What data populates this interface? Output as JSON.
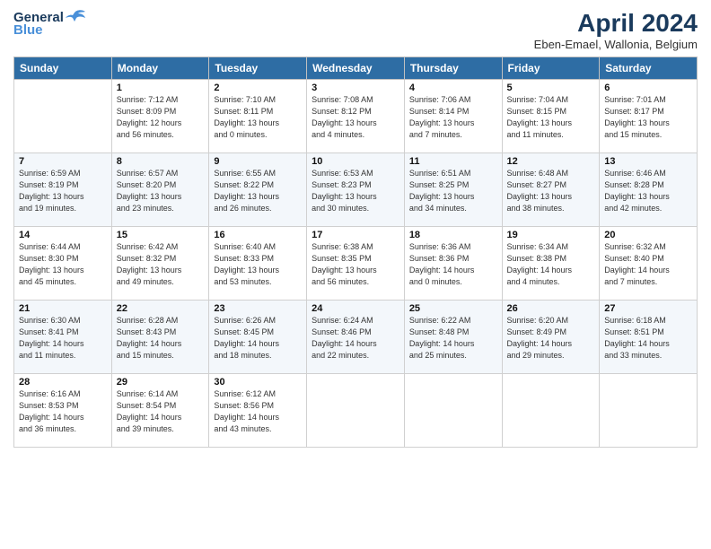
{
  "header": {
    "logo_general": "General",
    "logo_blue": "Blue",
    "title": "April 2024",
    "subtitle": "Eben-Emael, Wallonia, Belgium"
  },
  "days_of_week": [
    "Sunday",
    "Monday",
    "Tuesday",
    "Wednesday",
    "Thursday",
    "Friday",
    "Saturday"
  ],
  "weeks": [
    [
      {
        "day": "",
        "info": ""
      },
      {
        "day": "1",
        "info": "Sunrise: 7:12 AM\nSunset: 8:09 PM\nDaylight: 12 hours\nand 56 minutes."
      },
      {
        "day": "2",
        "info": "Sunrise: 7:10 AM\nSunset: 8:11 PM\nDaylight: 13 hours\nand 0 minutes."
      },
      {
        "day": "3",
        "info": "Sunrise: 7:08 AM\nSunset: 8:12 PM\nDaylight: 13 hours\nand 4 minutes."
      },
      {
        "day": "4",
        "info": "Sunrise: 7:06 AM\nSunset: 8:14 PM\nDaylight: 13 hours\nand 7 minutes."
      },
      {
        "day": "5",
        "info": "Sunrise: 7:04 AM\nSunset: 8:15 PM\nDaylight: 13 hours\nand 11 minutes."
      },
      {
        "day": "6",
        "info": "Sunrise: 7:01 AM\nSunset: 8:17 PM\nDaylight: 13 hours\nand 15 minutes."
      }
    ],
    [
      {
        "day": "7",
        "info": "Sunrise: 6:59 AM\nSunset: 8:19 PM\nDaylight: 13 hours\nand 19 minutes."
      },
      {
        "day": "8",
        "info": "Sunrise: 6:57 AM\nSunset: 8:20 PM\nDaylight: 13 hours\nand 23 minutes."
      },
      {
        "day": "9",
        "info": "Sunrise: 6:55 AM\nSunset: 8:22 PM\nDaylight: 13 hours\nand 26 minutes."
      },
      {
        "day": "10",
        "info": "Sunrise: 6:53 AM\nSunset: 8:23 PM\nDaylight: 13 hours\nand 30 minutes."
      },
      {
        "day": "11",
        "info": "Sunrise: 6:51 AM\nSunset: 8:25 PM\nDaylight: 13 hours\nand 34 minutes."
      },
      {
        "day": "12",
        "info": "Sunrise: 6:48 AM\nSunset: 8:27 PM\nDaylight: 13 hours\nand 38 minutes."
      },
      {
        "day": "13",
        "info": "Sunrise: 6:46 AM\nSunset: 8:28 PM\nDaylight: 13 hours\nand 42 minutes."
      }
    ],
    [
      {
        "day": "14",
        "info": "Sunrise: 6:44 AM\nSunset: 8:30 PM\nDaylight: 13 hours\nand 45 minutes."
      },
      {
        "day": "15",
        "info": "Sunrise: 6:42 AM\nSunset: 8:32 PM\nDaylight: 13 hours\nand 49 minutes."
      },
      {
        "day": "16",
        "info": "Sunrise: 6:40 AM\nSunset: 8:33 PM\nDaylight: 13 hours\nand 53 minutes."
      },
      {
        "day": "17",
        "info": "Sunrise: 6:38 AM\nSunset: 8:35 PM\nDaylight: 13 hours\nand 56 minutes."
      },
      {
        "day": "18",
        "info": "Sunrise: 6:36 AM\nSunset: 8:36 PM\nDaylight: 14 hours\nand 0 minutes."
      },
      {
        "day": "19",
        "info": "Sunrise: 6:34 AM\nSunset: 8:38 PM\nDaylight: 14 hours\nand 4 minutes."
      },
      {
        "day": "20",
        "info": "Sunrise: 6:32 AM\nSunset: 8:40 PM\nDaylight: 14 hours\nand 7 minutes."
      }
    ],
    [
      {
        "day": "21",
        "info": "Sunrise: 6:30 AM\nSunset: 8:41 PM\nDaylight: 14 hours\nand 11 minutes."
      },
      {
        "day": "22",
        "info": "Sunrise: 6:28 AM\nSunset: 8:43 PM\nDaylight: 14 hours\nand 15 minutes."
      },
      {
        "day": "23",
        "info": "Sunrise: 6:26 AM\nSunset: 8:45 PM\nDaylight: 14 hours\nand 18 minutes."
      },
      {
        "day": "24",
        "info": "Sunrise: 6:24 AM\nSunset: 8:46 PM\nDaylight: 14 hours\nand 22 minutes."
      },
      {
        "day": "25",
        "info": "Sunrise: 6:22 AM\nSunset: 8:48 PM\nDaylight: 14 hours\nand 25 minutes."
      },
      {
        "day": "26",
        "info": "Sunrise: 6:20 AM\nSunset: 8:49 PM\nDaylight: 14 hours\nand 29 minutes."
      },
      {
        "day": "27",
        "info": "Sunrise: 6:18 AM\nSunset: 8:51 PM\nDaylight: 14 hours\nand 33 minutes."
      }
    ],
    [
      {
        "day": "28",
        "info": "Sunrise: 6:16 AM\nSunset: 8:53 PM\nDaylight: 14 hours\nand 36 minutes."
      },
      {
        "day": "29",
        "info": "Sunrise: 6:14 AM\nSunset: 8:54 PM\nDaylight: 14 hours\nand 39 minutes."
      },
      {
        "day": "30",
        "info": "Sunrise: 6:12 AM\nSunset: 8:56 PM\nDaylight: 14 hours\nand 43 minutes."
      },
      {
        "day": "",
        "info": ""
      },
      {
        "day": "",
        "info": ""
      },
      {
        "day": "",
        "info": ""
      },
      {
        "day": "",
        "info": ""
      }
    ]
  ]
}
